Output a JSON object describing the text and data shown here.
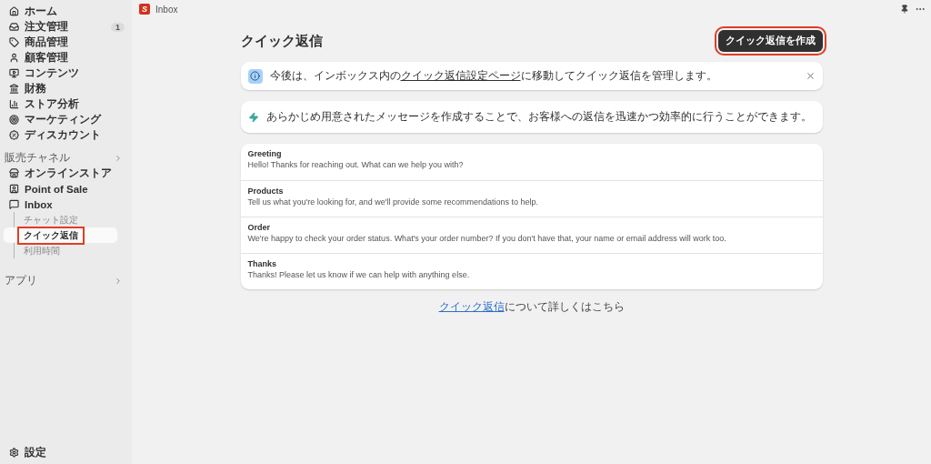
{
  "sidebar": {
    "items": [
      {
        "label": "ホーム"
      },
      {
        "label": "注文管理",
        "badge": "1"
      },
      {
        "label": "商品管理"
      },
      {
        "label": "顧客管理"
      },
      {
        "label": "コンテンツ"
      },
      {
        "label": "財務"
      },
      {
        "label": "ストア分析"
      },
      {
        "label": "マーケティング"
      },
      {
        "label": "ディスカウント"
      }
    ],
    "channels_heading": "販売チャネル",
    "channels": [
      {
        "label": "オンラインストア"
      },
      {
        "label": "Point of Sale"
      },
      {
        "label": "Inbox",
        "children": [
          {
            "label": "チャット設定",
            "selected": false,
            "highlighted": false
          },
          {
            "label": "クイック返信",
            "selected": true,
            "highlighted": true
          },
          {
            "label": "利用時間",
            "selected": false,
            "highlighted": false
          }
        ]
      }
    ],
    "apps_heading": "アプリ",
    "settings": "設定"
  },
  "topbar": {
    "logo": "S",
    "title": "Inbox"
  },
  "page": {
    "title": "クイック返信",
    "create_button": {
      "label": "クイック返信を作成",
      "highlighted": true
    },
    "banner": {
      "before": "今後は、インボックス内の",
      "link": "クイック返信設定ページ",
      "after": "に移動してクイック返信を管理します。"
    },
    "intro": "あらかじめ用意されたメッセージを作成することで、お客様への返信を迅速かつ効率的に行うことができます。",
    "replies": [
      {
        "title": "Greeting",
        "message": "Hello! Thanks for reaching out. What can we help you with?"
      },
      {
        "title": "Products",
        "message": "Tell us what you're looking for, and we'll provide some recommendations to help."
      },
      {
        "title": "Order",
        "message": "We're happy to check your order status. What's your order number? If you don't have that, your name or email address will work too."
      },
      {
        "title": "Thanks",
        "message": "Thanks! Please let us know if we can help with anything else."
      }
    ],
    "footer": {
      "link": "クイック返信",
      "text": "について詳しくはこちら"
    }
  }
}
